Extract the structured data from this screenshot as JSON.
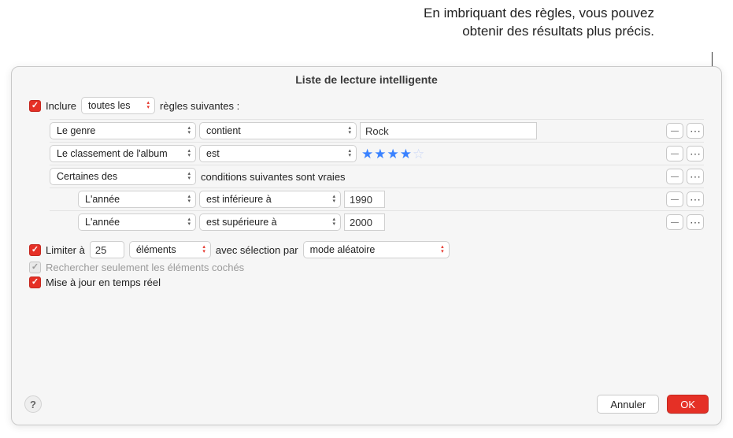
{
  "callout": {
    "line1": "En imbriquant des règles, vous pouvez",
    "line2": "obtenir des résultats plus précis."
  },
  "window": {
    "title": "Liste de lecture intelligente"
  },
  "matchRule": {
    "prefix": "Inclure",
    "mode": "toutes les",
    "suffix": "règles suivantes :"
  },
  "rules": [
    {
      "field": "Le genre",
      "op": "contient",
      "value": "Rock",
      "kind": "text"
    },
    {
      "field": "Le classement de l'album",
      "op": "est",
      "value": 4,
      "kind": "stars"
    }
  ],
  "group": {
    "mode": "Certaines des",
    "suffix": "conditions suivantes sont vraies",
    "rules": [
      {
        "field": "L'année",
        "op": "est inférieure à",
        "value": "1990"
      },
      {
        "field": "L'année",
        "op": "est supérieure à",
        "value": "2000"
      }
    ]
  },
  "limit": {
    "label": "Limiter à",
    "count": "25",
    "unit": "éléments",
    "selectedByLabel": "avec sélection par",
    "selectedBy": "mode aléatoire"
  },
  "onlyChecked": {
    "label": "Rechercher seulement les éléments cochés"
  },
  "liveUpdate": {
    "label": "Mise à jour en temps réel"
  },
  "buttons": {
    "cancel": "Annuler",
    "ok": "OK"
  }
}
